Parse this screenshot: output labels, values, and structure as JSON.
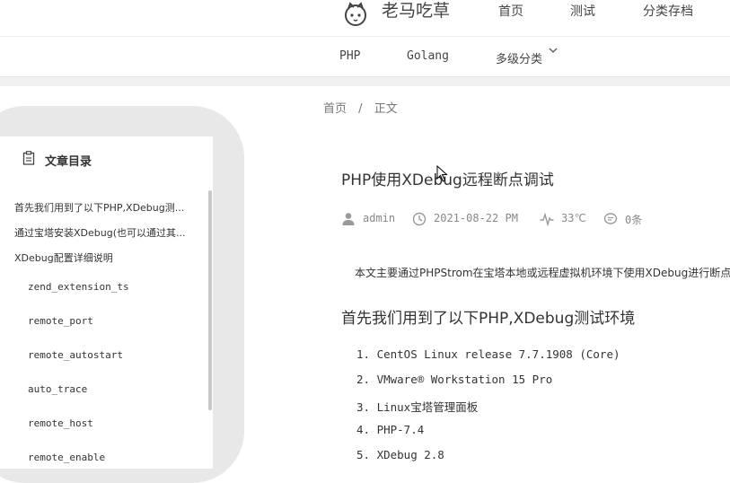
{
  "header": {
    "site_title": "老马吃草",
    "nav": [
      "首页",
      "测试",
      "分类存档"
    ]
  },
  "categories": [
    "PHP",
    "Golang",
    "多级分类"
  ],
  "toc": {
    "title": "文章目录",
    "items": [
      "首先我们用到了以下PHP,XDebug测...",
      "通过宝塔安装XDebug(也可以通过其...",
      "XDebug配置详细说明"
    ],
    "subitems": [
      "zend_extension_ts",
      "remote_port",
      "remote_autostart",
      "auto_trace",
      "remote_host",
      "remote_enable"
    ]
  },
  "breadcrumb": {
    "home": "首页",
    "separator": "/",
    "current": "正文"
  },
  "article": {
    "title": "PHP使用XDebug远程断点调试",
    "meta": {
      "author": "admin",
      "date": "2021-08-22 PM",
      "temperature": "33℃",
      "comments": "0条"
    },
    "intro": "本文主要通过PHPStrom在宝塔本地或远程虚拟机环境下使用XDebug进行断点调试",
    "section_heading": "首先我们用到了以下PHP,XDebug测试环境",
    "env_list": [
      "1. CentOS Linux release 7.7.1908 (Core)",
      "2. VMware® Workstation 15 Pro",
      "3. Linux宝塔管理面板",
      "4. PHP-7.4",
      "5. XDebug 2.8"
    ]
  },
  "icons": {
    "logo": "cat-logo-icon",
    "toc": "clipboard-icon",
    "author": "user-icon",
    "date": "clock-icon",
    "temperature": "pulse-icon",
    "comments": "comment-icon",
    "dropdown": "chevron-down-icon"
  }
}
